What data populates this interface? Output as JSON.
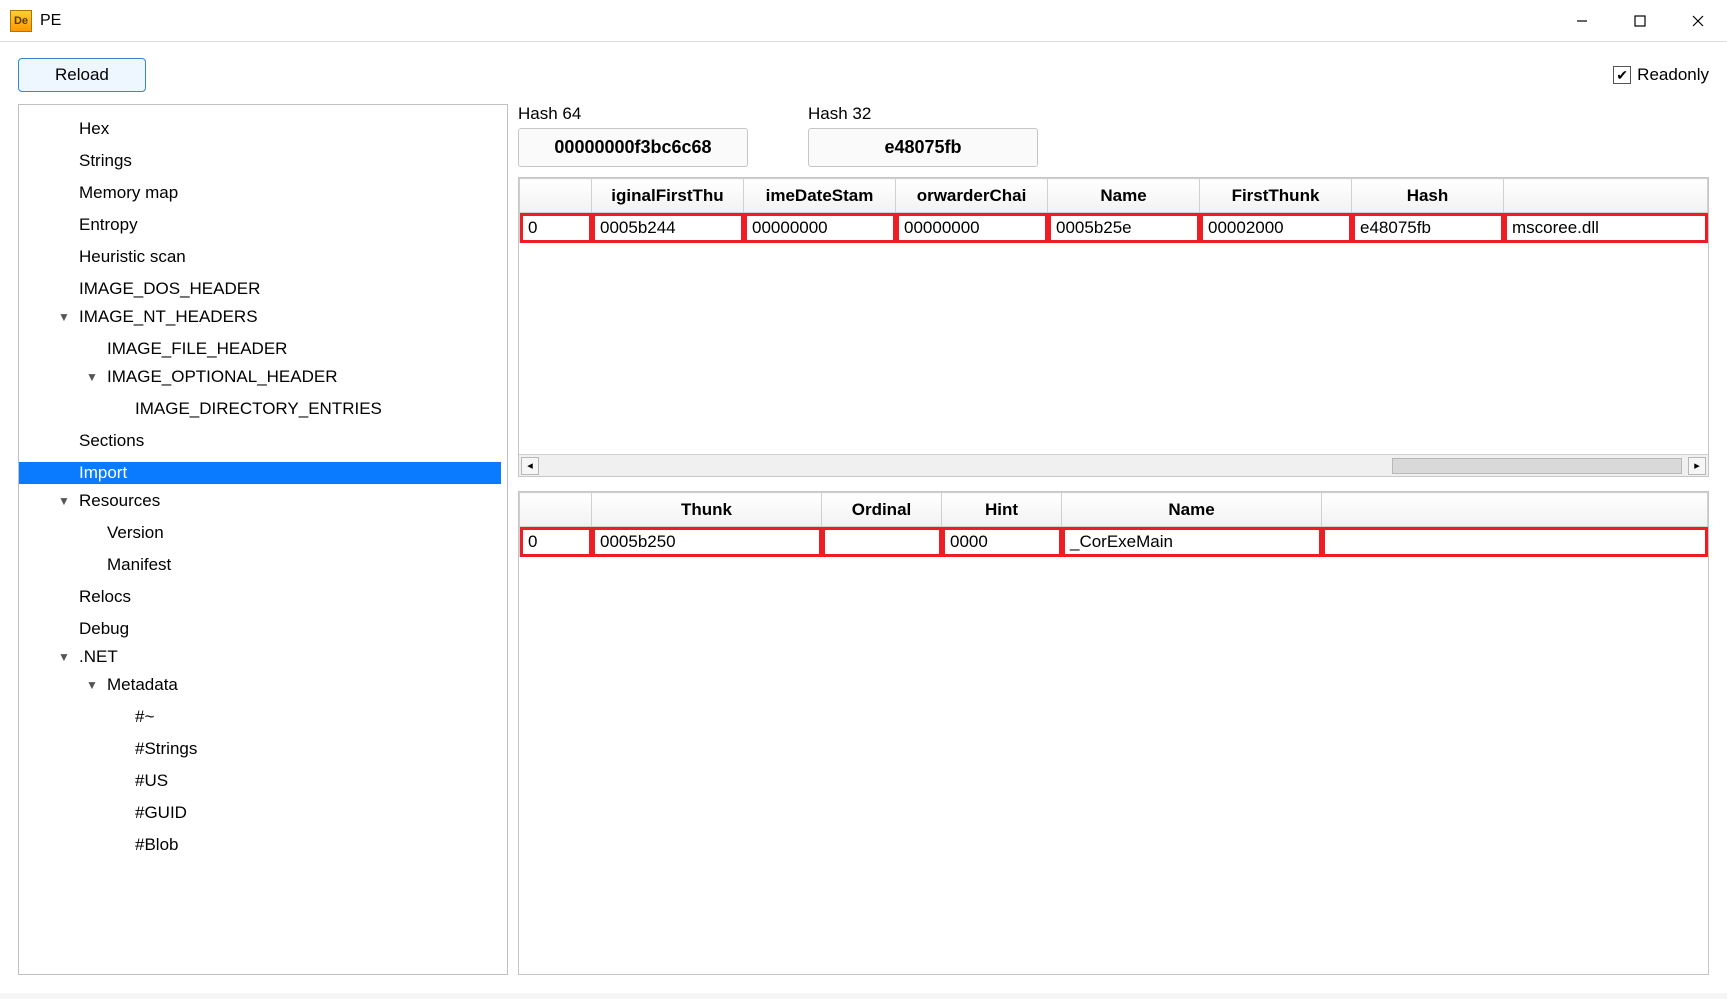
{
  "window": {
    "title": "PE",
    "app_icon_text": "De"
  },
  "toolbar": {
    "reload_label": "Reload",
    "readonly_label": "Readonly",
    "readonly_checked": true
  },
  "tree": {
    "items": [
      {
        "label": "Hex",
        "indent": 1
      },
      {
        "label": "Strings",
        "indent": 1
      },
      {
        "label": "Memory map",
        "indent": 1
      },
      {
        "label": "Entropy",
        "indent": 1
      },
      {
        "label": "Heuristic scan",
        "indent": 1
      },
      {
        "label": "IMAGE_DOS_HEADER",
        "indent": 1
      },
      {
        "label": "IMAGE_NT_HEADERS",
        "indent": 1,
        "expander": "▼"
      },
      {
        "label": "IMAGE_FILE_HEADER",
        "indent": 2
      },
      {
        "label": "IMAGE_OPTIONAL_HEADER",
        "indent": 2,
        "expander": "▼"
      },
      {
        "label": "IMAGE_DIRECTORY_ENTRIES",
        "indent": 3
      },
      {
        "label": "Sections",
        "indent": 1
      },
      {
        "label": "Import",
        "indent": 1,
        "selected": true
      },
      {
        "label": "Resources",
        "indent": 1,
        "expander": "▼"
      },
      {
        "label": "Version",
        "indent": 2
      },
      {
        "label": "Manifest",
        "indent": 2
      },
      {
        "label": "Relocs",
        "indent": 1
      },
      {
        "label": "Debug",
        "indent": 1
      },
      {
        "label": ".NET",
        "indent": 1,
        "expander": "▼"
      },
      {
        "label": "Metadata",
        "indent": 2,
        "expander": "▼"
      },
      {
        "label": "#~",
        "indent": 3
      },
      {
        "label": "#Strings",
        "indent": 3
      },
      {
        "label": "#US",
        "indent": 3
      },
      {
        "label": "#GUID",
        "indent": 3
      },
      {
        "label": "#Blob",
        "indent": 3
      }
    ]
  },
  "hashes": {
    "h64_label": "Hash 64",
    "h64_value": "00000000f3bc6c68",
    "h32_label": "Hash 32",
    "h32_value": "e48075fb"
  },
  "imports_table": {
    "headers": [
      "",
      "iginalFirstThu",
      "imeDateStam",
      "orwarderChai",
      "Name",
      "FirstThunk",
      "Hash",
      ""
    ],
    "row": {
      "idx": "0",
      "originalFirstThunk": "0005b244",
      "timeDateStamp": "00000000",
      "forwarderChain": "00000000",
      "name": "0005b25e",
      "firstThunk": "00002000",
      "hash": "e48075fb",
      "dll": "mscoree.dll"
    }
  },
  "funcs_table": {
    "headers": [
      "",
      "Thunk",
      "Ordinal",
      "Hint",
      "Name"
    ],
    "row": {
      "idx": "0",
      "thunk": "0005b250",
      "ordinal": "",
      "hint": "0000",
      "name": "_CorExeMain"
    }
  }
}
